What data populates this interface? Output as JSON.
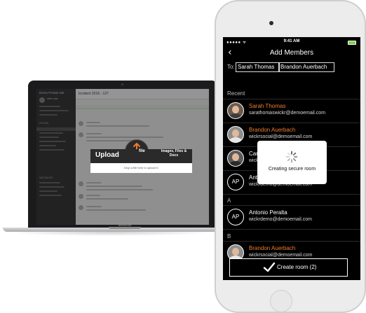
{
  "colors": {
    "accent_orange": "#f07c2b",
    "battery_green": "#7fd14b",
    "phone_bg": "#000000"
  },
  "laptop": {
    "brand_label": "MacBook",
    "sidebar_title": "Demo Private Net",
    "sidebar_username": "wickr user",
    "sidebar_section_rooms": "ROOMS",
    "sidebar_section_messages": "MESSAGES",
    "channel_title": "Incident 2016 - 127",
    "upload_word": "Upload",
    "upload_file": "file",
    "upload_types": "Images, Files & Docs",
    "upload_hint": "Drop a file here to upload it."
  },
  "phone": {
    "status": {
      "carrier": "●●●●● ᯤ",
      "time": "9:41 AM"
    },
    "nav": {
      "back_icon": "back-chevron-icon",
      "title": "Add Members"
    },
    "to": {
      "label": "To:",
      "chips": [
        "Sarah Thomas",
        "Brandon Auerbach"
      ]
    },
    "sections": {
      "recent": "Recent",
      "a": "A",
      "b": "B"
    },
    "recent": [
      {
        "name": "Sarah Thomas",
        "email": "sarathomaswickr@demoemail.com",
        "selected": true
      },
      {
        "name": "Brandon Auerbach",
        "email": "wickrsocial@demoemail.com",
        "selected": true
      },
      {
        "name": "Cameron Gonzalez",
        "email": "wickr@demoemail.com",
        "selected": false
      },
      {
        "name": "Antonio Peralta",
        "initials": "AP",
        "email": "wickrdemo@demoemail.com",
        "selected": false
      }
    ],
    "a_list": [
      {
        "name": "Antonio Peralta",
        "initials": "AP",
        "email": "wickrdemo@demoemail.com"
      }
    ],
    "b_list": [
      {
        "name": "Brandon Auerbach",
        "email": "wickrsocial@demoemail.com"
      }
    ],
    "loading": {
      "text": "Creating secure room"
    },
    "create_button": {
      "label": "Create room (2)"
    }
  }
}
